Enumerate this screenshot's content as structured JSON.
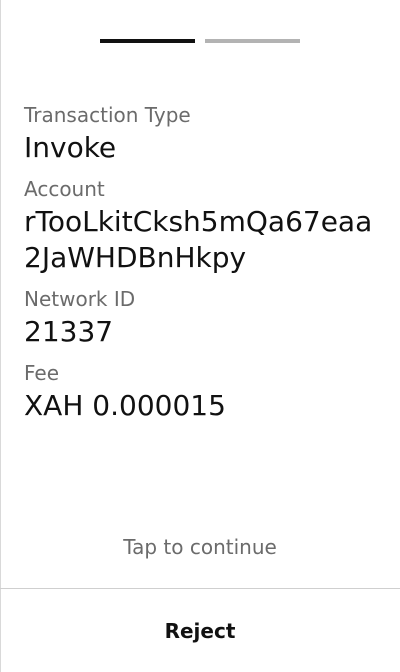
{
  "pager": {
    "total_steps": 2,
    "current_step": 1
  },
  "transaction": {
    "fields": [
      {
        "label": "Transaction Type",
        "value": "Invoke"
      },
      {
        "label": "Account",
        "value": "rTooLkitCksh5mQa67eaa2JaWHDBnHkpy"
      },
      {
        "label": "Network ID",
        "value": "21337"
      },
      {
        "label": "Fee",
        "value": "XAH 0.000015"
      }
    ]
  },
  "footer": {
    "tap_to_continue": "Tap to continue",
    "reject_label": "Reject"
  },
  "colors": {
    "text_primary": "#111111",
    "text_secondary": "#6b6b6b",
    "pager_active": "#111111",
    "pager_inactive": "#b3b3b3",
    "divider": "#cfcfcf"
  }
}
